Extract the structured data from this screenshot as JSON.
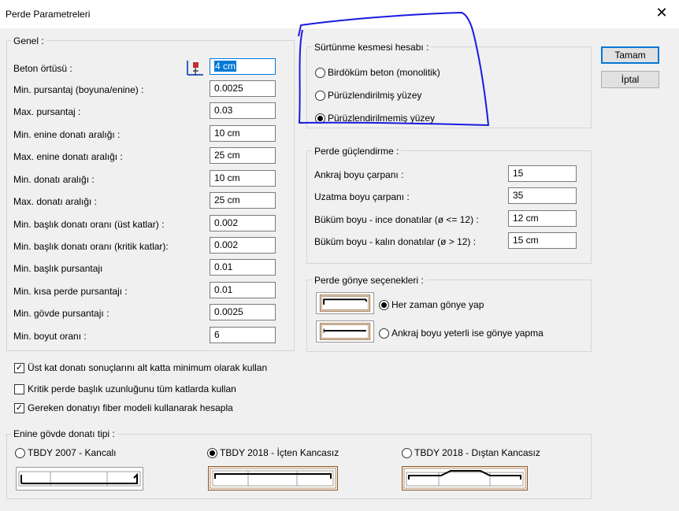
{
  "window": {
    "title": "Perde Parametreleri",
    "close_glyph": "✕"
  },
  "genel": {
    "title": "Genel :",
    "rows": [
      {
        "label": "Beton örtüsü :",
        "value": "4 cm"
      },
      {
        "label": "Min.  pursantaj (boyuna/enine) :",
        "value": "0.0025"
      },
      {
        "label": "Max. pursantaj :",
        "value": "0.03"
      },
      {
        "label": "Min. enine donatı aralığı :",
        "value": "10 cm"
      },
      {
        "label": "Max. enine donatı aralığı :",
        "value": "25 cm"
      },
      {
        "label": "Min. donatı aralığı :",
        "value": "10 cm"
      },
      {
        "label": "Max. donatı aralığı :",
        "value": "25 cm"
      },
      {
        "label": "Min. başlık donatı oranı (üst katlar) :",
        "value": "0.002"
      },
      {
        "label": "Min. başlık donatı oranı (kritik katlar):",
        "value": "0.002"
      },
      {
        "label": "Min. başlık pursantajı",
        "value": "0.01"
      },
      {
        "label": "Min. kısa perde pursantajı :",
        "value": "0.01"
      },
      {
        "label": "Min. gövde pursantajı :",
        "value": "0.0025"
      },
      {
        "label": "Min. boyut oranı :",
        "value": "6"
      }
    ]
  },
  "surtunme": {
    "title": "Sürtünme kesmesi hesabı :",
    "options": [
      {
        "label": "Birdöküm beton (monolitik)",
        "selected": false
      },
      {
        "label": "Pürüzlendirilmiş yüzey",
        "selected": false
      },
      {
        "label": "Pürüzlendirilmemiş yüzey",
        "selected": true
      }
    ],
    "annotation_color": "#1a1adf"
  },
  "guclendirme": {
    "title": "Perde güçlendirme :",
    "rows": [
      {
        "label": "Ankraj boyu çarpanı :",
        "value": "15"
      },
      {
        "label": "Uzatma boyu çarpanı :",
        "value": "35"
      },
      {
        "label": "Büküm boyu - ince donatılar (ø <= 12) :",
        "value": "12 cm"
      },
      {
        "label": "Büküm boyu - kalın donatılar (ø > 12) :",
        "value": "15 cm"
      }
    ]
  },
  "gonye": {
    "title": "Perde gönye seçenekleri :",
    "options": [
      {
        "label": "Her zaman gönye yap",
        "selected": true
      },
      {
        "label": "Ankraj boyu yeterli ise gönye yapma",
        "selected": false
      }
    ]
  },
  "checks": [
    {
      "label": "Üst kat donatı sonuçlarını alt katta minimum olarak kullan",
      "checked": true
    },
    {
      "label": "Kritik perde başlık uzunluğunu tüm katlarda kullan",
      "checked": false
    },
    {
      "label": "Gereken donatıyı fiber modeli kullanarak hesapla",
      "checked": true
    }
  ],
  "enine": {
    "title": "Enine gövde donatı tipi :",
    "options": [
      {
        "label": "TBDY 2007 - Kancalı",
        "selected": false
      },
      {
        "label": "TBDY 2018 - İçten Kancasız",
        "selected": true
      },
      {
        "label": "TBDY 2018 - Dıştan Kancasız",
        "selected": false
      }
    ]
  },
  "buttons": {
    "ok": "Tamam",
    "cancel": "İptal"
  },
  "check_glyph": "✓"
}
